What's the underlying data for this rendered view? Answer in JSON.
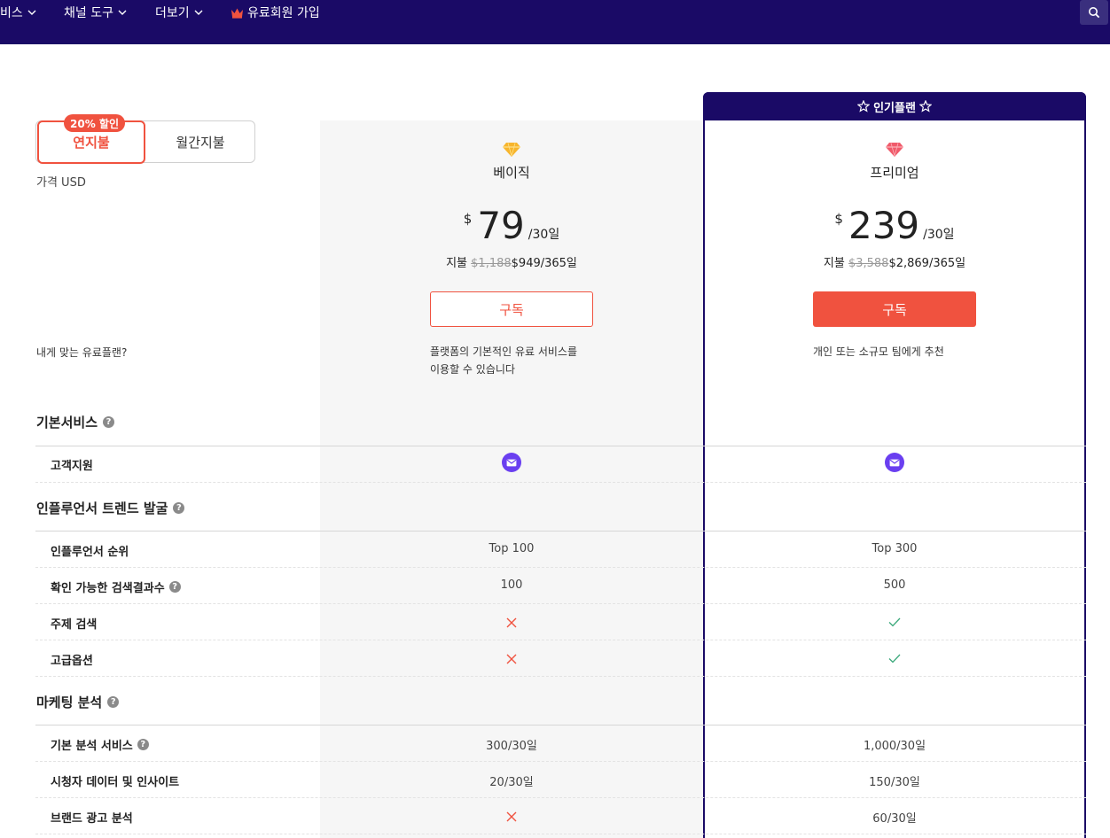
{
  "nav": {
    "items": [
      {
        "label": "비스",
        "dropdown": true
      },
      {
        "label": "채널 도구",
        "dropdown": true
      },
      {
        "label": "더보기",
        "dropdown": true
      },
      {
        "label": "유료회원 가입",
        "icon": "crown-icon"
      }
    ],
    "search_icon": "search-icon"
  },
  "billing": {
    "annual_label": "연지불",
    "monthly_label": "월간지불",
    "discount_badge": "20% 할인",
    "selected": "annual",
    "currency_note": "가격 USD"
  },
  "which_plan_label": "내게 맞는 유료플랜?",
  "plans": {
    "basic": {
      "name": "베이직",
      "icon": "diamond-yellow-icon",
      "currency": "$",
      "price": "79",
      "per": "/30일",
      "annual_prefix": "지불",
      "annual_original": "$1,188",
      "annual_price": "$949/365일",
      "button": "구독",
      "description_line1": "플랫폼의 기본적인 유료 서비스를",
      "description_line2": "이용할 수 있습니다"
    },
    "premium": {
      "badge": "인기플랜",
      "name": "프리미엄",
      "icon": "diamond-red-icon",
      "currency": "$",
      "price": "239",
      "per": "/30일",
      "annual_prefix": "지불",
      "annual_original": "$3,588",
      "annual_price": "$2,869/365일",
      "button": "구독",
      "description": "개인 또는 소규모 팀에게 추천"
    }
  },
  "sections": [
    {
      "title": "기본서비스",
      "rows": [
        {
          "label": "고객지원",
          "basic": "mail-icon",
          "premium": "mail-icon"
        }
      ]
    },
    {
      "title": "인플루언서 트렌드 발굴",
      "rows": [
        {
          "label": "인플루언서 순위",
          "basic": "Top 100",
          "premium": "Top 300"
        },
        {
          "label": "확인 가능한 검색결과수",
          "help": true,
          "basic": "100",
          "premium": "500"
        },
        {
          "label": "주제 검색",
          "basic": "cross-icon",
          "premium": "check-icon"
        },
        {
          "label": "고급옵션",
          "basic": "cross-icon",
          "premium": "check-icon"
        }
      ]
    },
    {
      "title": "마케팅 분석",
      "rows": [
        {
          "label": "기본 분석 서비스",
          "help": true,
          "basic": "300/30일",
          "premium": "1,000/30일"
        },
        {
          "label": "시청자 데이터 및 인사이트",
          "basic": "20/30일",
          "premium": "150/30일"
        },
        {
          "label": "브랜드 광고 분석",
          "basic": "cross-icon",
          "premium": "60/30일"
        }
      ]
    }
  ],
  "colors": {
    "nav_bg": "#1a0a66",
    "accent": "#f0523f",
    "mail_icon": "#6a3ff0",
    "check": "#3aa87a",
    "cross": "#f0523f"
  }
}
